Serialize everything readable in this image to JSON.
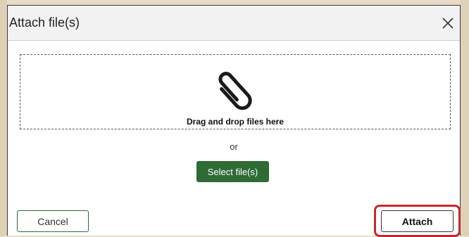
{
  "dialog": {
    "title": "Attach file(s)",
    "close_icon": "close-icon"
  },
  "drop_zone": {
    "icon": "paperclip-icon",
    "label": "Drag and drop files here"
  },
  "separator": {
    "text": "or"
  },
  "buttons": {
    "select_label": "Select file(s)",
    "cancel_label": "Cancel",
    "attach_label": "Attach"
  },
  "colors": {
    "primary_green": "#2e6b35",
    "highlight_red": "#c8262f",
    "header_bg": "#f2f2f2"
  }
}
